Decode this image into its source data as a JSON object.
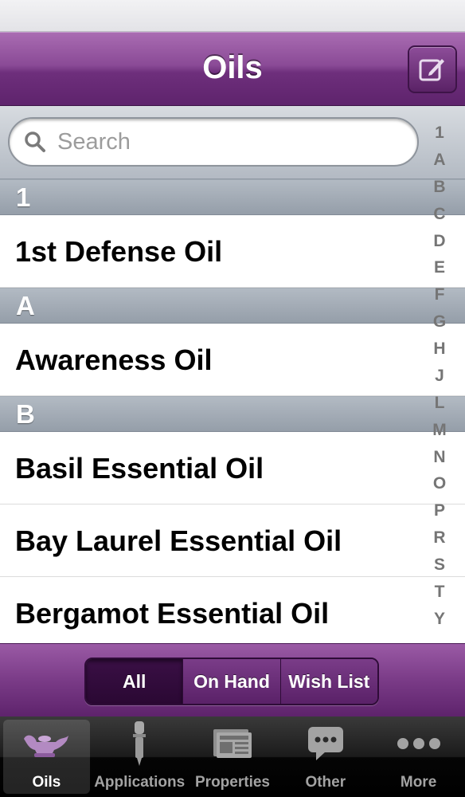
{
  "nav": {
    "title": "Oils",
    "edit_icon": "compose-icon"
  },
  "search": {
    "placeholder": "Search",
    "value": ""
  },
  "sections": [
    {
      "header": "1",
      "items": [
        "1st Defense Oil"
      ]
    },
    {
      "header": "A",
      "items": [
        "Awareness Oil"
      ]
    },
    {
      "header": "B",
      "items": [
        "Basil Essential Oil",
        "Bay Laurel Essential Oil",
        "Bergamot Essential Oil"
      ]
    }
  ],
  "index_letters": [
    "1",
    "A",
    "B",
    "C",
    "D",
    "E",
    "F",
    "G",
    "H",
    "J",
    "L",
    "M",
    "N",
    "O",
    "P",
    "R",
    "S",
    "T",
    "Y"
  ],
  "filter": {
    "segments": [
      "All",
      "On Hand",
      "Wish List"
    ],
    "selected": "All"
  },
  "tabbar": {
    "tabs": [
      {
        "label": "Oils",
        "icon": "lamp-icon",
        "selected": true
      },
      {
        "label": "Applications",
        "icon": "dropper-icon",
        "selected": false
      },
      {
        "label": "Properties",
        "icon": "newspaper-icon",
        "selected": false
      },
      {
        "label": "Other",
        "icon": "chat-bubble-icon",
        "selected": false
      },
      {
        "label": "More",
        "icon": "more-icon",
        "selected": false
      }
    ]
  },
  "colors": {
    "accent": "#6e2f7c",
    "section_header": "#a4acb6",
    "tabbar": "#111111"
  }
}
